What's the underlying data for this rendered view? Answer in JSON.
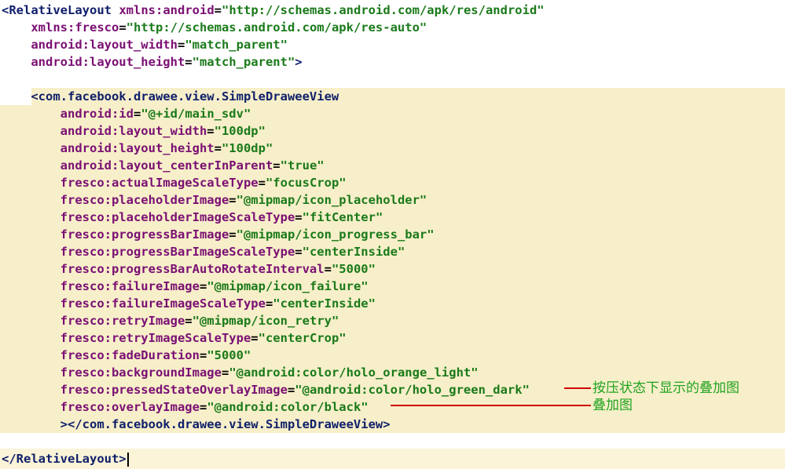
{
  "lines": [
    {
      "parts": [
        {
          "t": "<",
          "c": "tag"
        },
        {
          "t": "RelativeLayout",
          "c": "tag"
        },
        {
          "t": " ",
          "c": "punct"
        },
        {
          "t": "xmlns:android",
          "c": "attr"
        },
        {
          "t": "=",
          "c": "punct"
        },
        {
          "t": "\"http://schemas.android.com/apk/res/android\"",
          "c": "val"
        }
      ]
    },
    {
      "parts": [
        {
          "t": "    ",
          "c": "punct"
        },
        {
          "t": "xmlns:fresco",
          "c": "attr"
        },
        {
          "t": "=",
          "c": "punct"
        },
        {
          "t": "\"http://schemas.android.com/apk/res-auto\"",
          "c": "val"
        }
      ]
    },
    {
      "parts": [
        {
          "t": "    ",
          "c": "punct"
        },
        {
          "t": "android:layout_width",
          "c": "attr"
        },
        {
          "t": "=",
          "c": "punct"
        },
        {
          "t": "\"match_parent\"",
          "c": "val"
        }
      ]
    },
    {
      "parts": [
        {
          "t": "    ",
          "c": "punct"
        },
        {
          "t": "android:layout_height",
          "c": "attr"
        },
        {
          "t": "=",
          "c": "punct"
        },
        {
          "t": "\"match_parent\"",
          "c": "val"
        },
        {
          "t": ">",
          "c": "tag"
        }
      ]
    },
    {
      "parts": []
    },
    {
      "parts": [
        {
          "t": "    ",
          "c": "punct"
        },
        {
          "t": "<com.facebook.drawee.view.SimpleDraweeView",
          "c": "tag"
        }
      ]
    },
    {
      "parts": [
        {
          "t": "        ",
          "c": "punct"
        },
        {
          "t": "android:id",
          "c": "attr"
        },
        {
          "t": "=",
          "c": "punct"
        },
        {
          "t": "\"@+id/main_sdv\"",
          "c": "val"
        }
      ]
    },
    {
      "parts": [
        {
          "t": "        ",
          "c": "punct"
        },
        {
          "t": "android:layout_width",
          "c": "attr"
        },
        {
          "t": "=",
          "c": "punct"
        },
        {
          "t": "\"100dp\"",
          "c": "val"
        }
      ]
    },
    {
      "parts": [
        {
          "t": "        ",
          "c": "punct"
        },
        {
          "t": "android:layout_height",
          "c": "attr"
        },
        {
          "t": "=",
          "c": "punct"
        },
        {
          "t": "\"100dp\"",
          "c": "val"
        }
      ]
    },
    {
      "parts": [
        {
          "t": "        ",
          "c": "punct"
        },
        {
          "t": "android:layout_centerInParent",
          "c": "attr"
        },
        {
          "t": "=",
          "c": "punct"
        },
        {
          "t": "\"true\"",
          "c": "val"
        }
      ]
    },
    {
      "parts": [
        {
          "t": "        ",
          "c": "punct"
        },
        {
          "t": "fresco:actualImageScaleType",
          "c": "attr"
        },
        {
          "t": "=",
          "c": "punct"
        },
        {
          "t": "\"focusCrop\"",
          "c": "val"
        }
      ]
    },
    {
      "parts": [
        {
          "t": "        ",
          "c": "punct"
        },
        {
          "t": "fresco:placeholderImage",
          "c": "attr"
        },
        {
          "t": "=",
          "c": "punct"
        },
        {
          "t": "\"@mipmap/icon_placeholder\"",
          "c": "val"
        }
      ]
    },
    {
      "parts": [
        {
          "t": "        ",
          "c": "punct"
        },
        {
          "t": "fresco:placeholderImageScaleType",
          "c": "attr"
        },
        {
          "t": "=",
          "c": "punct"
        },
        {
          "t": "\"fitCenter\"",
          "c": "val"
        }
      ]
    },
    {
      "parts": [
        {
          "t": "        ",
          "c": "punct"
        },
        {
          "t": "fresco:progressBarImage",
          "c": "attr"
        },
        {
          "t": "=",
          "c": "punct"
        },
        {
          "t": "\"@mipmap/icon_progress_bar\"",
          "c": "val"
        }
      ]
    },
    {
      "parts": [
        {
          "t": "        ",
          "c": "punct"
        },
        {
          "t": "fresco:progressBarImageScaleType",
          "c": "attr"
        },
        {
          "t": "=",
          "c": "punct"
        },
        {
          "t": "\"centerInside\"",
          "c": "val"
        }
      ]
    },
    {
      "parts": [
        {
          "t": "        ",
          "c": "punct"
        },
        {
          "t": "fresco:progressBarAutoRotateInterval",
          "c": "attr"
        },
        {
          "t": "=",
          "c": "punct"
        },
        {
          "t": "\"5000\"",
          "c": "val"
        }
      ]
    },
    {
      "parts": [
        {
          "t": "        ",
          "c": "punct"
        },
        {
          "t": "fresco:failureImage",
          "c": "attr"
        },
        {
          "t": "=",
          "c": "punct"
        },
        {
          "t": "\"@mipmap/icon_failure\"",
          "c": "val"
        }
      ]
    },
    {
      "parts": [
        {
          "t": "        ",
          "c": "punct"
        },
        {
          "t": "fresco:failureImageScaleType",
          "c": "attr"
        },
        {
          "t": "=",
          "c": "punct"
        },
        {
          "t": "\"centerInside\"",
          "c": "val"
        }
      ]
    },
    {
      "parts": [
        {
          "t": "        ",
          "c": "punct"
        },
        {
          "t": "fresco:retryImage",
          "c": "attr"
        },
        {
          "t": "=",
          "c": "punct"
        },
        {
          "t": "\"@mipmap/icon_retry\"",
          "c": "val"
        }
      ]
    },
    {
      "parts": [
        {
          "t": "        ",
          "c": "punct"
        },
        {
          "t": "fresco:retryImageScaleType",
          "c": "attr"
        },
        {
          "t": "=",
          "c": "punct"
        },
        {
          "t": "\"centerCrop\"",
          "c": "val"
        }
      ]
    },
    {
      "parts": [
        {
          "t": "        ",
          "c": "punct"
        },
        {
          "t": "fresco:fadeDuration",
          "c": "attr"
        },
        {
          "t": "=",
          "c": "punct"
        },
        {
          "t": "\"5000\"",
          "c": "val"
        }
      ]
    },
    {
      "parts": [
        {
          "t": "        ",
          "c": "punct"
        },
        {
          "t": "fresco:backgroundImage",
          "c": "attr"
        },
        {
          "t": "=",
          "c": "punct"
        },
        {
          "t": "\"@android:color/holo_orange_light\"",
          "c": "val"
        }
      ]
    },
    {
      "parts": [
        {
          "t": "        ",
          "c": "punct"
        },
        {
          "t": "fresco:pressedStateOverlayImage",
          "c": "attr"
        },
        {
          "t": "=",
          "c": "punct"
        },
        {
          "t": "\"@android:color/holo_green_dark\"",
          "c": "val"
        }
      ]
    },
    {
      "parts": [
        {
          "t": "        ",
          "c": "punct"
        },
        {
          "t": "fresco:overlayImage",
          "c": "attr"
        },
        {
          "t": "=",
          "c": "punct"
        },
        {
          "t": "\"@android:color/black\"",
          "c": "val"
        }
      ]
    },
    {
      "parts": [
        {
          "t": "        ",
          "c": "punct"
        },
        {
          "t": "></com.facebook.drawee.view.SimpleDraweeView>",
          "c": "tag"
        }
      ]
    },
    {
      "parts": []
    },
    {
      "parts": [
        {
          "t": "</RelativeLayout>",
          "c": "tag"
        }
      ]
    }
  ],
  "annotations": {
    "pressed_overlay": "按压状态下显示的叠加图",
    "overlay": "叠加图"
  },
  "colors": {
    "tag": "#0f1f6a",
    "attribute": "#7a0f73",
    "value": "#1a7a1a",
    "highlight": "#f7efc9",
    "annotation_line": "#d10000",
    "annotation_text": "#21a321"
  }
}
